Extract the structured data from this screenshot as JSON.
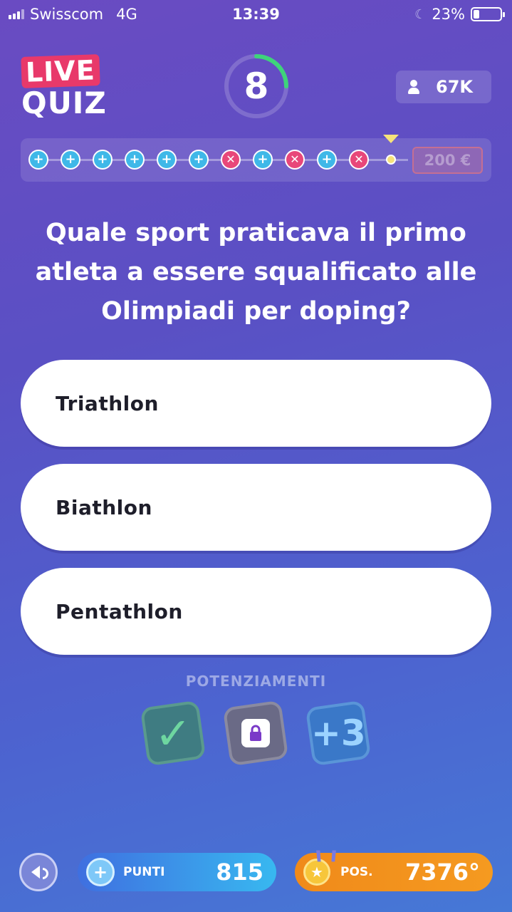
{
  "status_bar": {
    "carrier": "Swisscom",
    "network": "4G",
    "time": "13:39",
    "battery": "23%",
    "battery_level": 0.23
  },
  "header": {
    "logo_live": "LIVE",
    "logo_quiz": "QUIZ",
    "timer": "8",
    "timer_fraction": 0.25,
    "players": "67K"
  },
  "progress": {
    "results": [
      "correct",
      "correct",
      "correct",
      "correct",
      "correct",
      "correct",
      "wrong",
      "correct",
      "wrong",
      "correct",
      "wrong"
    ],
    "prize": "200 €"
  },
  "question": "Quale sport praticava il primo atleta a essere squalificato alle Olimpiadi per doping?",
  "answers": [
    "Triathlon",
    "Biathlon",
    "Pentathlon"
  ],
  "powerups": {
    "title": "POTENZIAMENTI",
    "items": [
      "check-icon",
      "lock-icon",
      "plus-three-icon"
    ],
    "plus_three_label": "+3"
  },
  "footer": {
    "points_label": "PUNTI",
    "points_value": "815",
    "position_label": "POS.",
    "position_value": "7376°"
  },
  "colors": {
    "background_top": "#6a4bc2",
    "background_bottom": "#4678d6",
    "correct": "#3fb8e8",
    "wrong": "#e8477a",
    "live_badge": "#e8396a",
    "points_bar": "#38b8f0",
    "position_bar": "#f08a1a"
  }
}
